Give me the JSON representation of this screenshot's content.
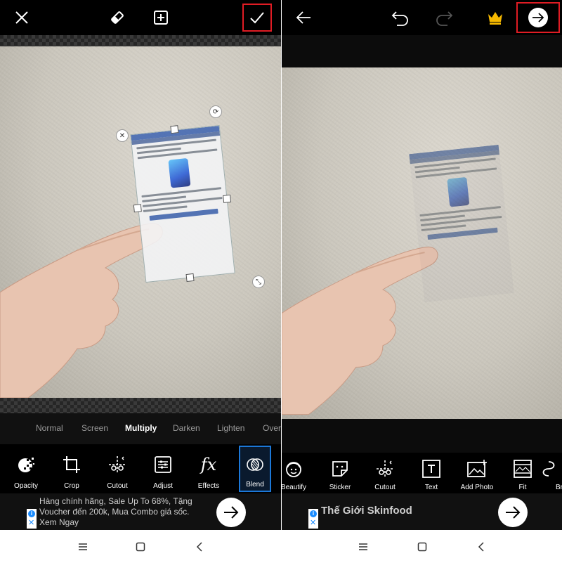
{
  "left_screen": {
    "toolbar": {
      "close_icon": "x-icon",
      "eraser_icon": "eraser-icon",
      "add_icon": "plus-square-icon",
      "confirm_icon": "check-icon"
    },
    "blend_modes": [
      {
        "label": "Normal",
        "selected": false
      },
      {
        "label": "Screen",
        "selected": false
      },
      {
        "label": "Multiply",
        "selected": true
      },
      {
        "label": "Darken",
        "selected": false
      },
      {
        "label": "Lighten",
        "selected": false
      },
      {
        "label": "Over",
        "selected": false
      }
    ],
    "tools": [
      {
        "label": "Opacity",
        "icon": "opacity-icon"
      },
      {
        "label": "Crop",
        "icon": "crop-icon"
      },
      {
        "label": "Cutout",
        "icon": "cutout-icon"
      },
      {
        "label": "Adjust",
        "icon": "adjust-icon"
      },
      {
        "label": "Effects",
        "icon": "fx-icon"
      },
      {
        "label": "Blend",
        "icon": "blend-icon",
        "active": true
      }
    ],
    "ad": {
      "text": "Hàng chính hãng, Sale Up To 68%, Tặng Voucher đến 200k, Mua Combo giá sốc. Xem Ngay"
    }
  },
  "right_screen": {
    "toolbar": {
      "back_icon": "arrow-left-icon",
      "undo_icon": "undo-icon",
      "redo_icon": "redo-icon",
      "premium_icon": "crown-icon",
      "next_icon": "arrow-right-circle-icon"
    },
    "tools": [
      {
        "label": "Beautify",
        "icon": "beautify-icon"
      },
      {
        "label": "Sticker",
        "icon": "sticker-icon"
      },
      {
        "label": "Cutout",
        "icon": "cutout-icon"
      },
      {
        "label": "Text",
        "icon": "text-icon"
      },
      {
        "label": "Add Photo",
        "icon": "add-photo-icon"
      },
      {
        "label": "Fit",
        "icon": "fit-icon"
      },
      {
        "label": "Br",
        "icon": "brush-icon"
      }
    ],
    "ad": {
      "brand": "Thế Giới Skinfood"
    }
  },
  "colors": {
    "highlight": "#e01c24",
    "active_tool": "#1c78d8",
    "crown": "#f5b800"
  }
}
